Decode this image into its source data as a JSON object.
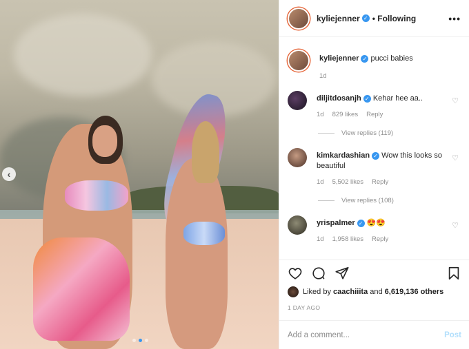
{
  "header": {
    "username": "kyliejenner",
    "verified_glyph": "✓",
    "follow_status": "• Following",
    "more": "•••"
  },
  "caption": {
    "username": "kyliejenner",
    "text": "pucci babies",
    "time": "1d"
  },
  "comments": [
    {
      "username": "diljitdosanjh",
      "text": "Kehar hee aa..",
      "time": "1d",
      "likes": "829 likes",
      "reply": "Reply",
      "view_replies": "View replies (119)",
      "avatar_icon": "avatar-diljitdosanjh"
    },
    {
      "username": "kimkardashian",
      "text": "Wow this looks so beautiful",
      "time": "1d",
      "likes": "5,502 likes",
      "reply": "Reply",
      "view_replies": "View replies (108)",
      "avatar_icon": "avatar-kimkardashian"
    },
    {
      "username": "yrispalmer",
      "text": "😍😍",
      "time": "1d",
      "likes": "1,958 likes",
      "reply": "Reply",
      "avatar_icon": "avatar-yrispalmer"
    }
  ],
  "actions": {
    "liked_prefix": "Liked by",
    "liked_user": "caachiiita",
    "liked_and": "and",
    "liked_count": "6,619,136 others",
    "time_ago": "1 DAY AGO"
  },
  "add_comment": {
    "placeholder": "Add a comment...",
    "post_label": "Post"
  },
  "media": {
    "prev_arrow": "‹",
    "carousel_total": 3,
    "carousel_active": 2
  },
  "colors": {
    "verified": "#3897f0",
    "post_disabled": "#b2dffc",
    "muted": "#8e8e8e"
  }
}
